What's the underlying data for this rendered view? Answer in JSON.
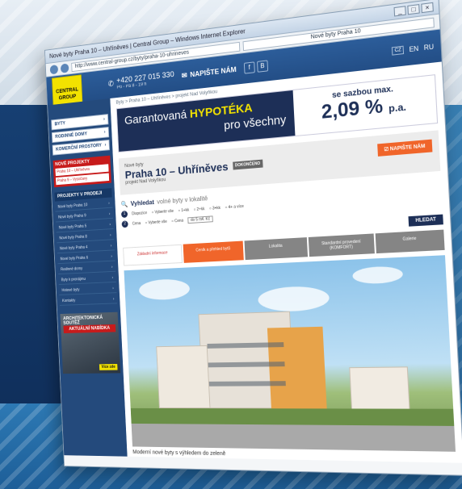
{
  "browser": {
    "title": "Nové byty Praha 10 – Uhříněves | Central Group – Windows Internet Explorer",
    "url": "http://www.central-group.cz/byty/praha-10-uhrineves",
    "tab": "Nové byty Praha 10",
    "window_buttons": [
      "_",
      "□",
      "×"
    ]
  },
  "header": {
    "logo_line1": "CENTRAL",
    "logo_line2": "GROUP",
    "phone": "+420 227 015 330",
    "phone_sub": "Po - Pá 8 - 19 h",
    "contact": "NAPIŠTE NÁM",
    "social": [
      "f",
      "B"
    ],
    "langs": [
      "CZ",
      "EN",
      "RU"
    ]
  },
  "sidebar": {
    "buttons": [
      "BYTY",
      "RODINNÉ DOMY",
      "KOMERČNÍ PROSTORY"
    ],
    "promo_head": "NOVÉ PROJEKTY",
    "promo_items": [
      "Praha 10 – Uhříněves",
      "Praha 9 – Vysočany"
    ],
    "projects_head": "PROJEKTY V PRODEJI",
    "projects": [
      "Nové byty Praha 10",
      "Nové byty Praha 9",
      "Nové byty Praha 5",
      "Nové byty Praha 8",
      "Nové byty Praha 4",
      "Nové byty Praha 6",
      "Rodinné domy",
      "Byty k pronájmu",
      "Hotové byty",
      "Kontakty"
    ],
    "banner_title": "ARCHITEKTONICKÁ SOUTĚŽ",
    "banner_red": "AKTUÁLNÍ NABÍDKA",
    "banner_cta": "Více zde"
  },
  "main": {
    "breadcrumb": "Byty > Praha 10 – Uhříněves > projekt Nad Volyňkou",
    "hero": {
      "line1_prefix": "Garantovaná",
      "line1_highlight": "HYPOTÉKA",
      "line2": "pro všechny",
      "rate_label": "se sazbou max.",
      "rate_value": "2,09 %",
      "rate_unit": "p.a."
    },
    "project": {
      "kicker": "Nové byty",
      "name": "Praha 10 – Uhříněves",
      "status": "DOKONČENO",
      "sub": "projekt Nad Volyňkou",
      "write_btn": "NAPIŠTE NÁM"
    },
    "search": {
      "head": "Vyhledat",
      "head_light": "volné byty v lokalitě",
      "row1_label": "Dispozice",
      "row1_opts": [
        "Vyberte vše",
        "1+kk",
        "2+kk",
        "3+kk",
        "4+ a více"
      ],
      "row2_label": "Cena",
      "row2_opts": [
        "Vyberte vše",
        "Cena"
      ],
      "row2_select": "do 5 mil. Kč",
      "button": "HLEDAT"
    },
    "tabs": [
      "Základní informace",
      "Ceník a přehled bytů",
      "Lokalita",
      "Standardní provedení (KOMFORT)",
      "Galerie"
    ],
    "caption": "Moderní nové byty s výhledem do zeleně"
  },
  "colors": {
    "brand_navy": "#1d2f57",
    "accent_orange": "#f0652a",
    "logo_yellow": "#f2e200",
    "sidebar_blue": "#244a7c"
  }
}
